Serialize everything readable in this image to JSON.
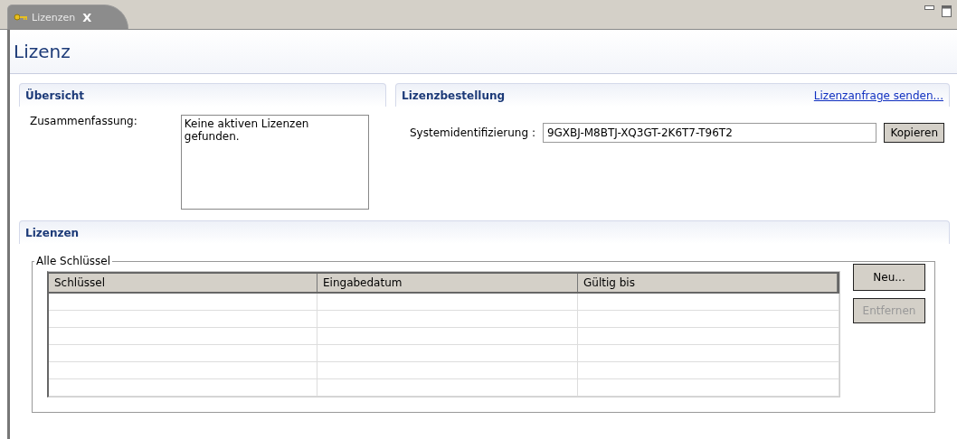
{
  "tab": {
    "label": "Lizenzen",
    "close": "X",
    "selected": true
  },
  "title": "Lizenz",
  "overview": {
    "heading": "Übersicht",
    "label": "Zusammenfassung:",
    "value": "Keine aktiven Lizenzen gefunden."
  },
  "order": {
    "heading": "Lizenzbestellung",
    "link": "Lizenzanfrage senden...",
    "label": "Systemidentifizierung :",
    "value": "9GXBJ-M8BTJ-XQ3GT-2K6T7-T96T2",
    "button": "Kopieren"
  },
  "licenses": {
    "heading": "Lizenzen",
    "group": "Alle Schlüssel",
    "columns": [
      "Schlüssel",
      "Eingabedatum",
      "Gültig bis"
    ],
    "buttons": [
      {
        "label": "Neu...",
        "disabled": false
      },
      {
        "label": "Entfernen",
        "disabled": true
      }
    ]
  }
}
